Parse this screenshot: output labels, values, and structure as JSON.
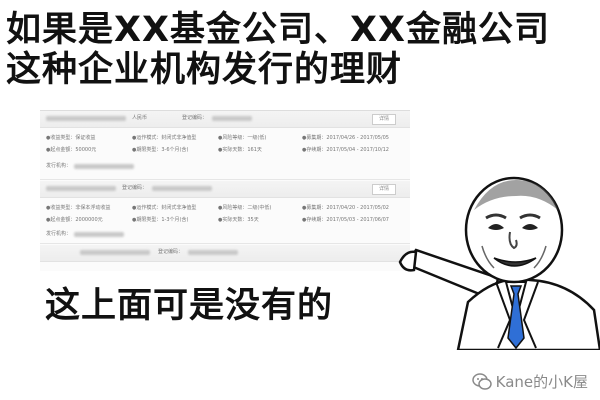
{
  "headline": {
    "line1": "如果是XX基金公司、XX金融公司",
    "line2": "这种企业机构发行的理财"
  },
  "bottom_text": "这上面可是没有的",
  "screenshot": {
    "card1": {
      "header_mid": "人民币",
      "header_code": "登记编码：",
      "button": "详情",
      "row1": [
        "●收益类型：保证收益",
        "●运作模式：封闭式非净值型",
        "●风险等级：一级(低)",
        "●募集期：2017/04/26 - 2017/05/05"
      ],
      "row2": [
        "●起点金额：50000元",
        "●期限类型：3-6个月(含)",
        "●实际天数：161天",
        "●存续期：2017/05/04 - 2017/10/12"
      ],
      "issuer": "发行机构："
    },
    "card2": {
      "header_code": "登记编码：",
      "button": "详情",
      "row1": [
        "●收益类型：非保本浮动收益",
        "●运作模式：封闭式非净值型",
        "●风险等级：二级(中低)",
        "●募集期：2017/04/20 - 2017/05/02"
      ],
      "row2": [
        "●起点金额：2000000元",
        "●期限类型：1-3个月(含)",
        "●实际天数：35天",
        "●存续期：2017/05/03 - 2017/06/07"
      ],
      "issuer": "发行机构："
    },
    "card3": {
      "header_code": "登记编码："
    }
  },
  "watermark": {
    "text": "Kane的小K屋",
    "icon": "wechat-icon"
  },
  "colors": {
    "text": "#111111",
    "watermark": "#8a8a8a",
    "tie": "#2f6fd6"
  }
}
